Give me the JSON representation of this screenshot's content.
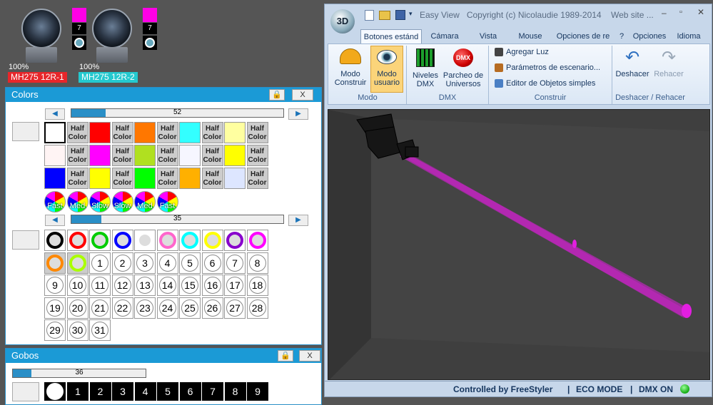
{
  "fixtures": [
    {
      "name": "MH275 12R-1",
      "intensity": "100%",
      "name_bg": "#e8262a",
      "channel": "7",
      "top_color": "#ff00e6",
      "dot_color": "#67a9be"
    },
    {
      "name": "MH275 12R-2",
      "intensity": "100%",
      "name_bg": "#24c9cf",
      "channel": "7",
      "top_color": "#ff00e6",
      "dot_color": "#67a9be"
    }
  ],
  "colors_panel": {
    "title": "Colors",
    "lock_icon": "lock-icon",
    "close_label": "X",
    "slider1": {
      "value": "52",
      "fraction": 0.16
    },
    "slider2": {
      "value": "35",
      "fraction": 0.14
    },
    "half_label": "Half Color",
    "color_rows": [
      [
        "#ffffff",
        "half",
        "#ff0000",
        "half",
        "#ff7700",
        "half",
        "#33ffff",
        "half",
        "#ffffa0",
        "half"
      ],
      [
        "#fff4f4",
        "half",
        "#ff00ff",
        "half",
        "#b0e020",
        "half",
        "#f6f6ff",
        "half",
        "#ffff00",
        "half"
      ],
      [
        "#0000ff",
        "half",
        "#ffff00",
        "half",
        "#00ff00",
        "half",
        "#ffb000",
        "half",
        "#dde6ff",
        "half"
      ]
    ],
    "fade_labels": [
      "Fast",
      "Med",
      "Slow",
      "Slow",
      "Med",
      "Fast"
    ],
    "wheel_rings": [
      "#000000",
      "#ff0000",
      "#00cc00",
      "#0000ff",
      "#ffffff",
      "#ff66cc",
      "#00ffff",
      "#ffff00",
      "#8800cc",
      "#ff00ff",
      "#ff8800",
      "#aaff00"
    ],
    "numbers": [
      "1",
      "2",
      "3",
      "4",
      "5",
      "6",
      "7",
      "8",
      "9",
      "10",
      "11",
      "12",
      "13",
      "14",
      "15",
      "16",
      "17",
      "18",
      "19",
      "20",
      "21",
      "22",
      "23",
      "24",
      "25",
      "26",
      "27",
      "28",
      "29",
      "30",
      "31"
    ]
  },
  "gobos_panel": {
    "title": "Gobos",
    "close_label": "X",
    "slider": {
      "value": "36",
      "fraction": 0.14
    },
    "gobos": [
      "1",
      "2",
      "3",
      "4",
      "5",
      "6",
      "7",
      "8",
      "9"
    ]
  },
  "app": {
    "title": "Easy View",
    "copyright": "Copyright (c) Nicolaudie 1989-2014",
    "website": "Web site ...",
    "tabs": [
      "Botones estánd",
      "Cámara",
      "Vista",
      "Mouse",
      "Opciones de re"
    ],
    "right_menu": [
      "?",
      "Opciones",
      "Idioma"
    ],
    "modo": {
      "label": "Modo",
      "construir": "Modo Construir",
      "usuario": "Modo usuario"
    },
    "dmx": {
      "label": "DMX",
      "niveles": "Niveles DMX",
      "parcheo": "Parcheo de Universos"
    },
    "construir": {
      "label": "Construir",
      "agregar": "Agregar Luz",
      "parametros": "Parámetros de escenario...",
      "editor": "Editor de Objetos simples"
    },
    "undo": {
      "label": "Deshacer / Rehacer",
      "deshacer": "Deshacer",
      "rehacer": "Rehacer"
    },
    "status": {
      "controlled": "Controlled by FreeStyler",
      "eco": "ECO MODE",
      "dmx": "DMX ON"
    },
    "beam_color": "#e21ee0"
  }
}
